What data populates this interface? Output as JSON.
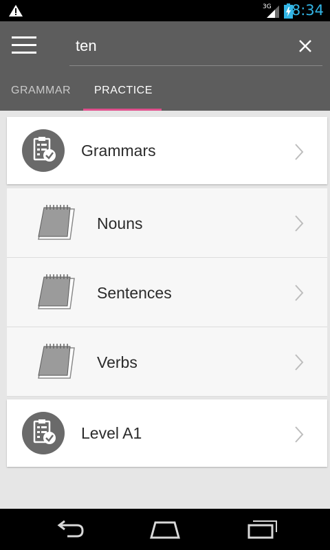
{
  "status_bar": {
    "network": "3G",
    "time": "8:34",
    "icons": [
      "warning-icon",
      "signal-icon",
      "battery-charging-icon"
    ]
  },
  "app_bar": {
    "search": {
      "value": "ten",
      "placeholder": ""
    },
    "tabs": [
      {
        "label": "GRAMMAR",
        "selected": false
      },
      {
        "label": "PRACTICE",
        "selected": true
      }
    ],
    "colors": {
      "background": "#5d5d5d",
      "tab_indicator": "#e0508d"
    }
  },
  "list": {
    "grammars": {
      "label": "Grammars",
      "icon": "clipboard-check-icon"
    },
    "children": [
      {
        "label": "Nouns",
        "icon": "notepad-icon"
      },
      {
        "label": "Sentences",
        "icon": "notepad-icon"
      },
      {
        "label": "Verbs",
        "icon": "notepad-icon"
      }
    ],
    "level": {
      "label": "Level A1",
      "icon": "clipboard-check-icon"
    }
  },
  "nav_bar": {
    "icons": [
      "back-icon",
      "home-icon",
      "recent-apps-icon"
    ]
  }
}
